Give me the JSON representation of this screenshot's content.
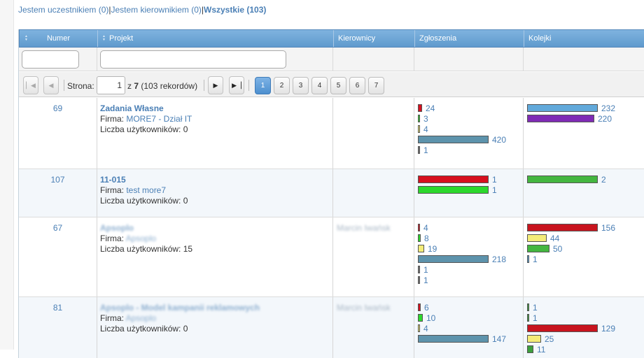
{
  "filters": {
    "participant": "Jestem uczestnikiem (0)",
    "sep1": "|",
    "manager": "Jestem kierownikiem (0)",
    "sep2": "|",
    "all": "Wszystkie (103)"
  },
  "columns": {
    "numer": "Numer",
    "projekt": "Projekt",
    "kierownicy": "Kierownicy",
    "zgloszenia": "Zgłoszenia",
    "kolejki": "Kolejki"
  },
  "pager": {
    "page_label": "Strona:",
    "current_page": "1",
    "of_prefix": "z",
    "total_pages": "7",
    "records": "(103 rekordów)",
    "pages": [
      "1",
      "2",
      "3",
      "4",
      "5",
      "6",
      "7"
    ]
  },
  "colors": {
    "red": "#d7101e",
    "green": "#2cd82c",
    "yellow": "#f4ec78",
    "steel": "#5d93ac",
    "purple": "#7f2bb5",
    "dark_red": "#c8141e",
    "medium_green": "#44b640",
    "light_blue": "#61a9db",
    "dark_green": "#3c9f3c",
    "accent_link": "#4a7fb5"
  },
  "rows": [
    {
      "numer": "69",
      "title": "Zadania Własne",
      "title_blurred": false,
      "firma_label": "Firma:",
      "firma": "MORE7 - Dział IT",
      "firma_blurred": false,
      "users_label": "Liczba użytkowników:",
      "users": "0",
      "kierownicy": "",
      "zgloszenia": [
        {
          "value": "24",
          "color": "#d7101e",
          "scale": 0.057
        },
        {
          "value": "3",
          "color": "#2cd82c",
          "scale": 0.007
        },
        {
          "value": "4",
          "color": "#f4ec78",
          "scale": 0.01
        },
        {
          "value": "420",
          "color": "#5d93ac",
          "scale": 1.0
        },
        {
          "value": "1",
          "color": "#7a7a7a",
          "scale": 0.002
        }
      ],
      "kolejki": [
        {
          "value": "232",
          "color": "#61a9db",
          "scale": 1.0
        },
        {
          "value": "220",
          "color": "#7f2bb5",
          "scale": 0.948
        }
      ]
    },
    {
      "numer": "107",
      "title": "11-015",
      "title_blurred": false,
      "firma_label": "Firma:",
      "firma": "test more7",
      "firma_blurred": false,
      "users_label": "Liczba użytkowników:",
      "users": "0",
      "kierownicy": "",
      "zgloszenia": [
        {
          "value": "1",
          "color": "#d7101e",
          "scale": 1.0
        },
        {
          "value": "1",
          "color": "#2cd82c",
          "scale": 1.0
        }
      ],
      "kolejki": [
        {
          "value": "2",
          "color": "#44b640",
          "scale": 1.0
        }
      ]
    },
    {
      "numer": "67",
      "title": "Apsoplo",
      "title_blurred": true,
      "firma_label": "Firma:",
      "firma": "Apsoplo",
      "firma_blurred": true,
      "users_label": "Liczba użytkowników:",
      "users": "15",
      "kierownicy": "Marcin Iwańsk",
      "zgloszenia": [
        {
          "value": "4",
          "color": "#d7101e",
          "scale": 0.018
        },
        {
          "value": "8",
          "color": "#2cd82c",
          "scale": 0.037
        },
        {
          "value": "19",
          "color": "#f4ec78",
          "scale": 0.087
        },
        {
          "value": "218",
          "color": "#5d93ac",
          "scale": 1.0
        },
        {
          "value": "1",
          "color": "#7a7a7a",
          "scale": 0.005
        },
        {
          "value": "1",
          "color": "#7a7a7a",
          "scale": 0.005
        }
      ],
      "kolejki": [
        {
          "value": "156",
          "color": "#c8141e",
          "scale": 1.0
        },
        {
          "value": "44",
          "color": "#f4ec78",
          "scale": 0.282
        },
        {
          "value": "50",
          "color": "#44b640",
          "scale": 0.321
        },
        {
          "value": "1",
          "color": "#61a9db",
          "scale": 0.006
        }
      ]
    },
    {
      "numer": "81",
      "title": "Apsoplo - Model kampanii reklamowych",
      "title_blurred": true,
      "firma_label": "Firma:",
      "firma": "Apsoplo",
      "firma_blurred": true,
      "users_label": "Liczba użytkowników:",
      "users": "0",
      "kierownicy": "Marcin Iwańsk",
      "zgloszenia": [
        {
          "value": "6",
          "color": "#d7101e",
          "scale": 0.041
        },
        {
          "value": "10",
          "color": "#2cd82c",
          "scale": 0.068
        },
        {
          "value": "4",
          "color": "#f4ec78",
          "scale": 0.027
        },
        {
          "value": "147",
          "color": "#5d93ac",
          "scale": 1.0
        }
      ],
      "kolejki": [
        {
          "value": "1",
          "color": "#3c9f3c",
          "scale": 0.008
        },
        {
          "value": "1",
          "color": "#3c9f3c",
          "scale": 0.008
        },
        {
          "value": "129",
          "color": "#c8141e",
          "scale": 1.0
        },
        {
          "value": "25",
          "color": "#f4ec78",
          "scale": 0.194
        },
        {
          "value": "11",
          "color": "#3c9f3c",
          "scale": 0.085
        }
      ]
    }
  ]
}
